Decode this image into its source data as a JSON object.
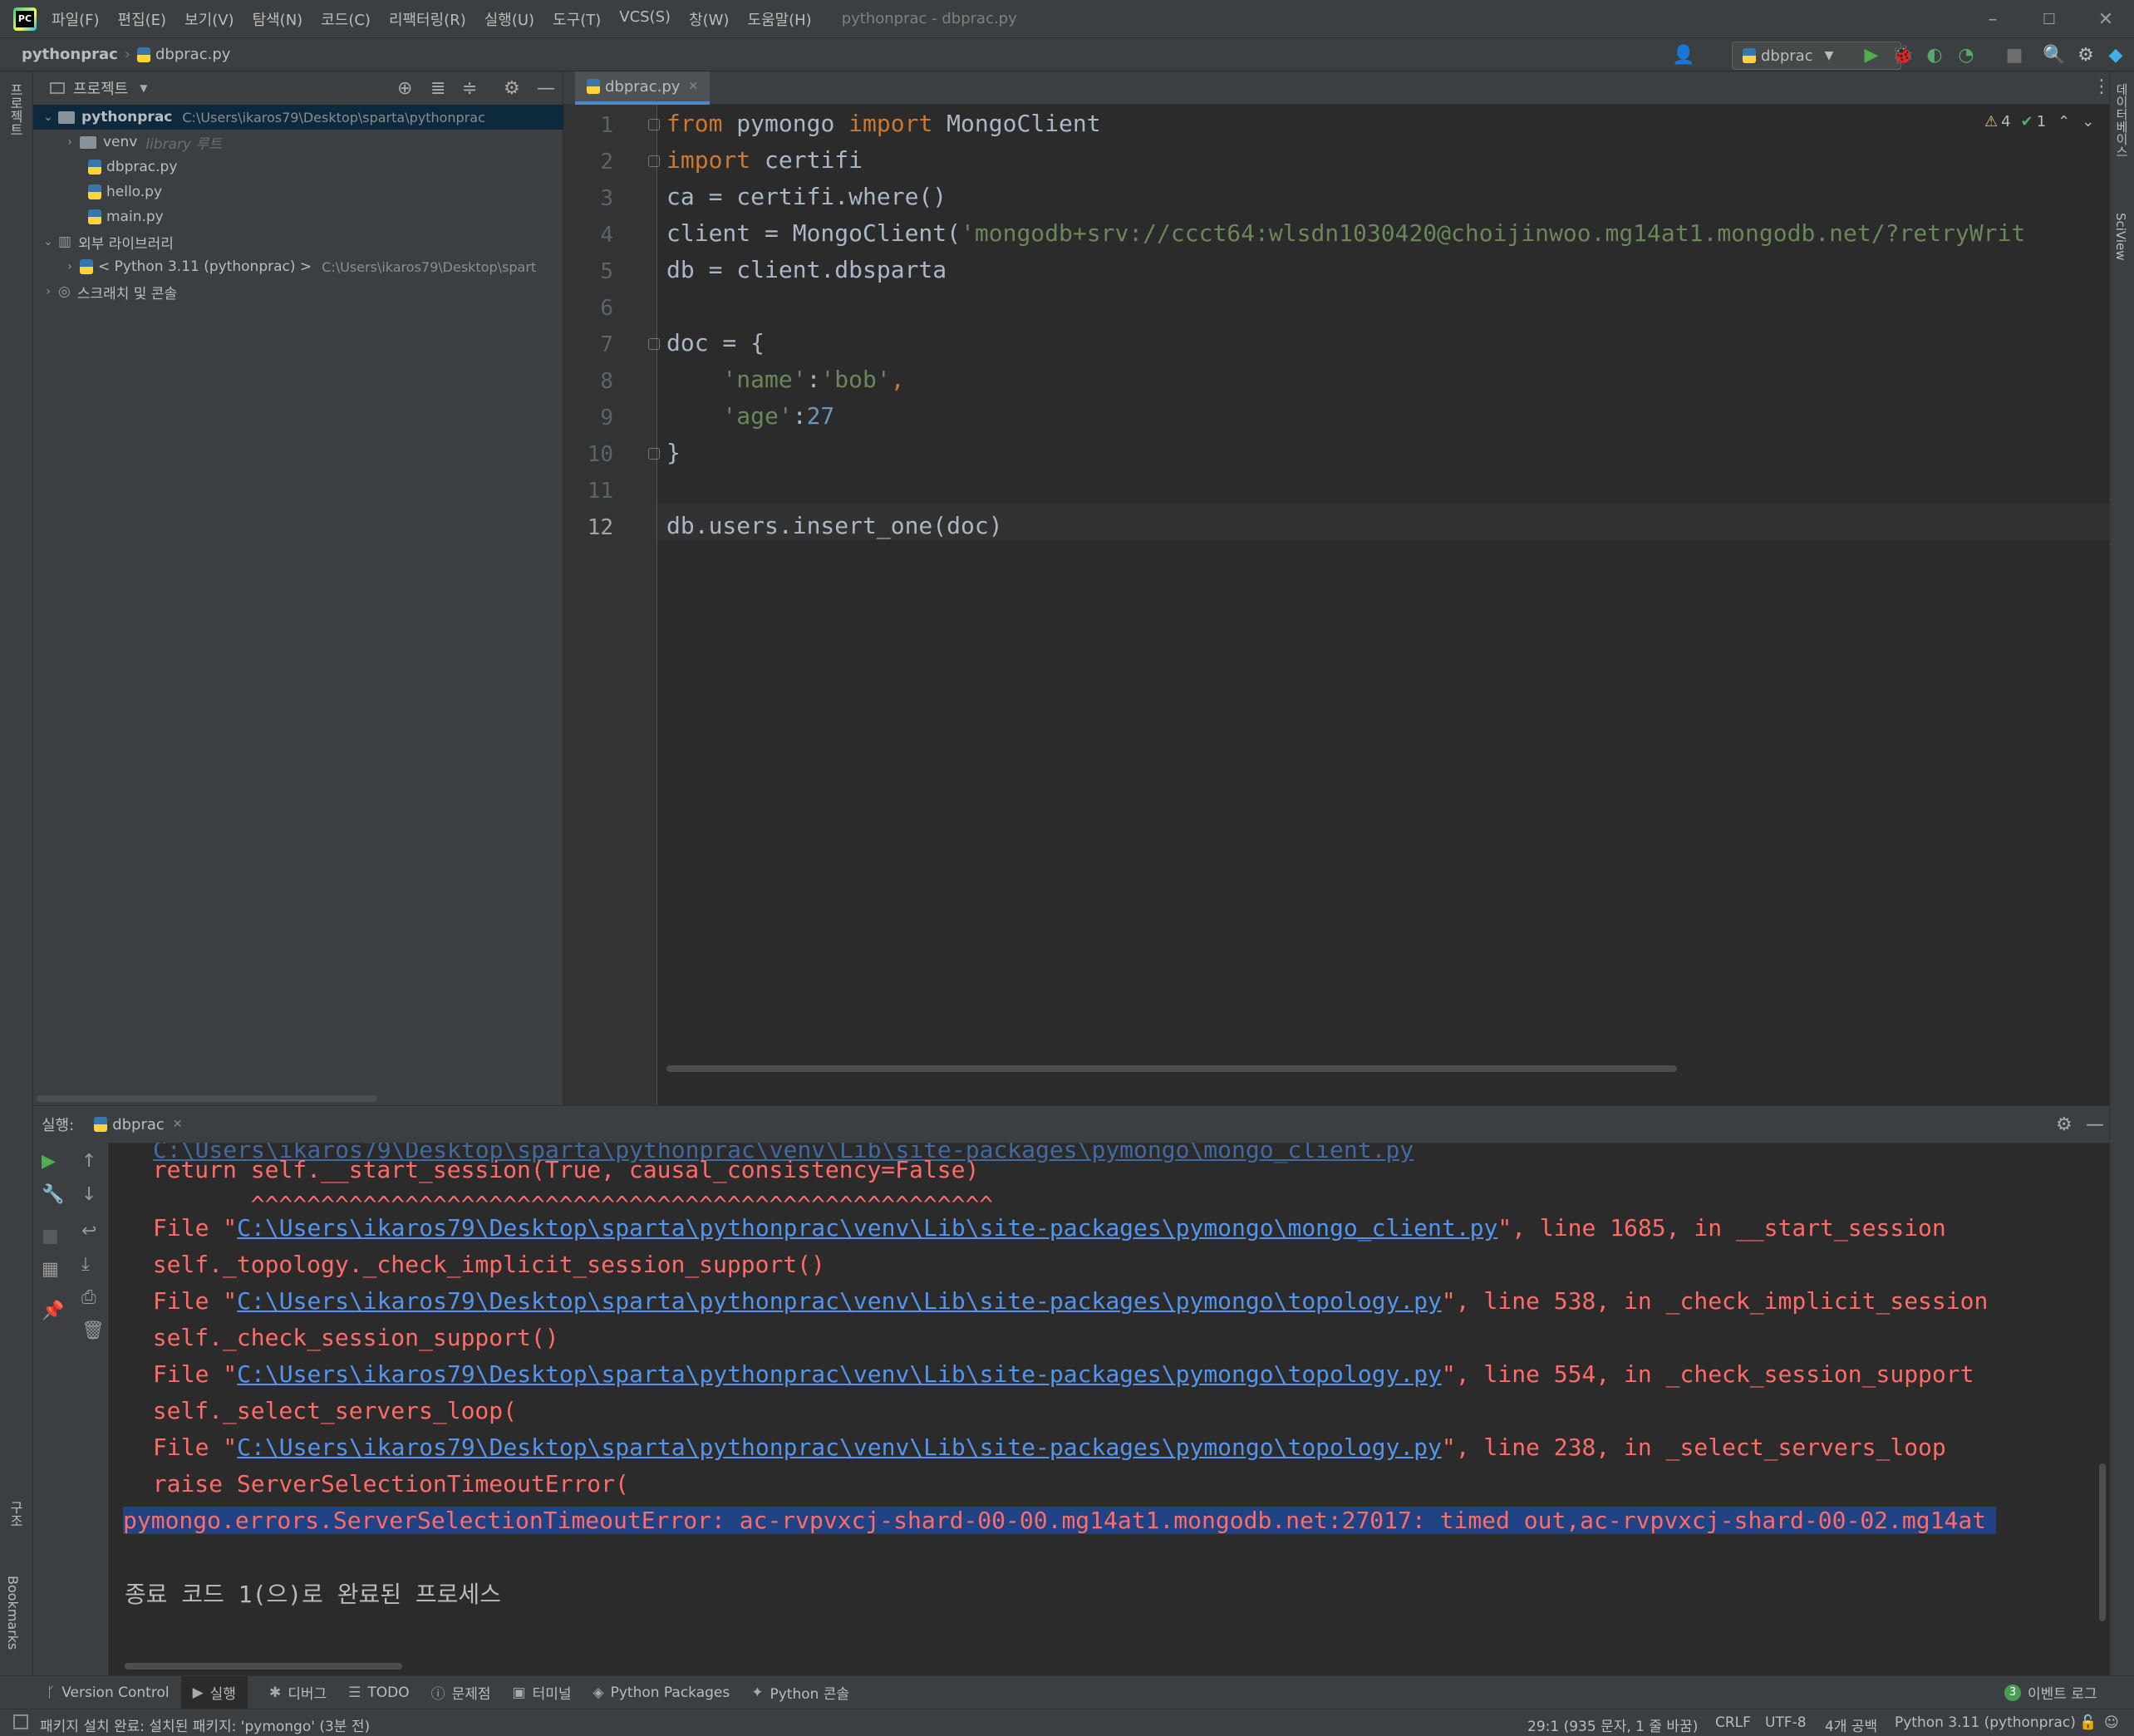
{
  "window": {
    "title": "pythonprac - dbprac.py",
    "menu": [
      "파일(F)",
      "편집(E)",
      "보기(V)",
      "탐색(N)",
      "코드(C)",
      "리팩터링(R)",
      "실행(U)",
      "도구(T)",
      "VCS(S)",
      "창(W)",
      "도움말(H)"
    ],
    "controls": {
      "minimize": "–",
      "maximize": "☐",
      "close": "✕"
    }
  },
  "navbar": {
    "project": "pythonprac",
    "file": "dbprac.py",
    "run_config": "dbprac"
  },
  "left_stripe": {
    "project_tab": "프로젝트",
    "structure_tab": "구조",
    "bookmarks_tab": "Bookmarks"
  },
  "right_stripe": {
    "database_tab": "데이터베이스",
    "sciview_tab": "SciView"
  },
  "project_panel": {
    "title": "프로젝트",
    "tree": [
      {
        "label": "pythonprac",
        "path": "C:\\Users\\ikaros79\\Desktop\\sparta\\pythonprac",
        "type": "folder",
        "expanded": true,
        "selected": true
      },
      {
        "label": "venv",
        "extra": "library 루트",
        "type": "folder",
        "expanded": false
      },
      {
        "label": "dbprac.py",
        "type": "py"
      },
      {
        "label": "hello.py",
        "type": "py"
      },
      {
        "label": "main.py",
        "type": "py"
      },
      {
        "label": "외부 라이브러리",
        "type": "lib",
        "expanded": true
      },
      {
        "label": "< Python 3.11 (pythonprac) >",
        "path": "C:\\Users\\ikaros79\\Desktop\\spart",
        "type": "python"
      },
      {
        "label": "스크래치 및 콘솔",
        "type": "scratch"
      }
    ]
  },
  "editor": {
    "tab": "dbprac.py",
    "inspections": {
      "warnings": "4",
      "weak_warnings": "1"
    },
    "line_numbers": [
      "1",
      "2",
      "3",
      "4",
      "5",
      "6",
      "7",
      "8",
      "9",
      "10",
      "11",
      "12"
    ],
    "lines": {
      "l1_from": "from",
      "l1_mod": " pymongo ",
      "l1_import": "import",
      "l1_name": " MongoClient",
      "l2_import": "import",
      "l2_mod": " certifi",
      "l3": "ca = certifi.where()",
      "l4_pre": "client = MongoClient(",
      "l4_str": "'mongodb+srv://ccct64:wlsdn1030420@choijinwoo.mg14at1.mongodb.net/?retryWrit",
      "l5": "db = client.dbsparta",
      "l7": "doc = {",
      "l8_key": "    'name'",
      "l8_colon": ":",
      "l8_val": "'bob'",
      "l8_comma": ",",
      "l9_key": "    'age'",
      "l9_colon": ":",
      "l9_val": "27",
      "l10": "}",
      "l12": "db.users.insert_one(doc)"
    }
  },
  "run_panel": {
    "label": "실행:",
    "tab": "dbprac",
    "output": {
      "o0": "  return self.__start_session(True, causal_consistency=False)",
      "o1": "         ^^^^^^^^^^^^^^^^^^^^^^^^^^^^^^^^^^^^^^^^^^^^^^^^^^^^^",
      "o2_pre": "File \"",
      "o2_link": "C:\\Users\\ikaros79\\Desktop\\sparta\\pythonprac\\venv\\Lib\\site-packages\\pymongo\\mongo_client.py",
      "o2_post": "\", line 1685, in __start_session",
      "o3": "  self._topology._check_implicit_session_support()",
      "o4_pre": "File \"",
      "o4_link": "C:\\Users\\ikaros79\\Desktop\\sparta\\pythonprac\\venv\\Lib\\site-packages\\pymongo\\topology.py",
      "o4_post": "\", line 538, in _check_implicit_session",
      "o5": "  self._check_session_support()",
      "o6_pre": "File \"",
      "o6_link": "C:\\Users\\ikaros79\\Desktop\\sparta\\pythonprac\\venv\\Lib\\site-packages\\pymongo\\topology.py",
      "o6_post": "\", line 554, in _check_session_support",
      "o7": "  self._select_servers_loop(",
      "o8_pre": "File \"",
      "o8_link": "C:\\Users\\ikaros79\\Desktop\\sparta\\pythonprac\\venv\\Lib\\site-packages\\pymongo\\topology.py",
      "o8_post": "\", line 238, in _select_servers_loop",
      "o9": "  raise ServerSelectionTimeoutError(",
      "o10": "pymongo.errors.ServerSelectionTimeoutError: ac-rvpvxcj-shard-00-00.mg14at1.mongodb.net:27017: timed out,ac-rvpvxcj-shard-00-02.mg14at",
      "o11": "종료 코드 1(으)로 완료된 프로세스"
    }
  },
  "tool_tabs": [
    "Version Control",
    "실행",
    "디버그",
    "TODO",
    "문제점",
    "터미널",
    "Python Packages",
    "Python 콘솔"
  ],
  "event_log": {
    "count": "3",
    "label": "이벤트 로그"
  },
  "status": {
    "message": "패키지 설치 완료: 설치된 패키지: 'pymongo' (3분 전)",
    "position": "29:1 (935 문자, 1 줄 바꿈)",
    "line_sep": "CRLF",
    "encoding": "UTF-8",
    "indent": "4개 공백",
    "interpreter": "Python 3.11 (pythonprac)"
  }
}
